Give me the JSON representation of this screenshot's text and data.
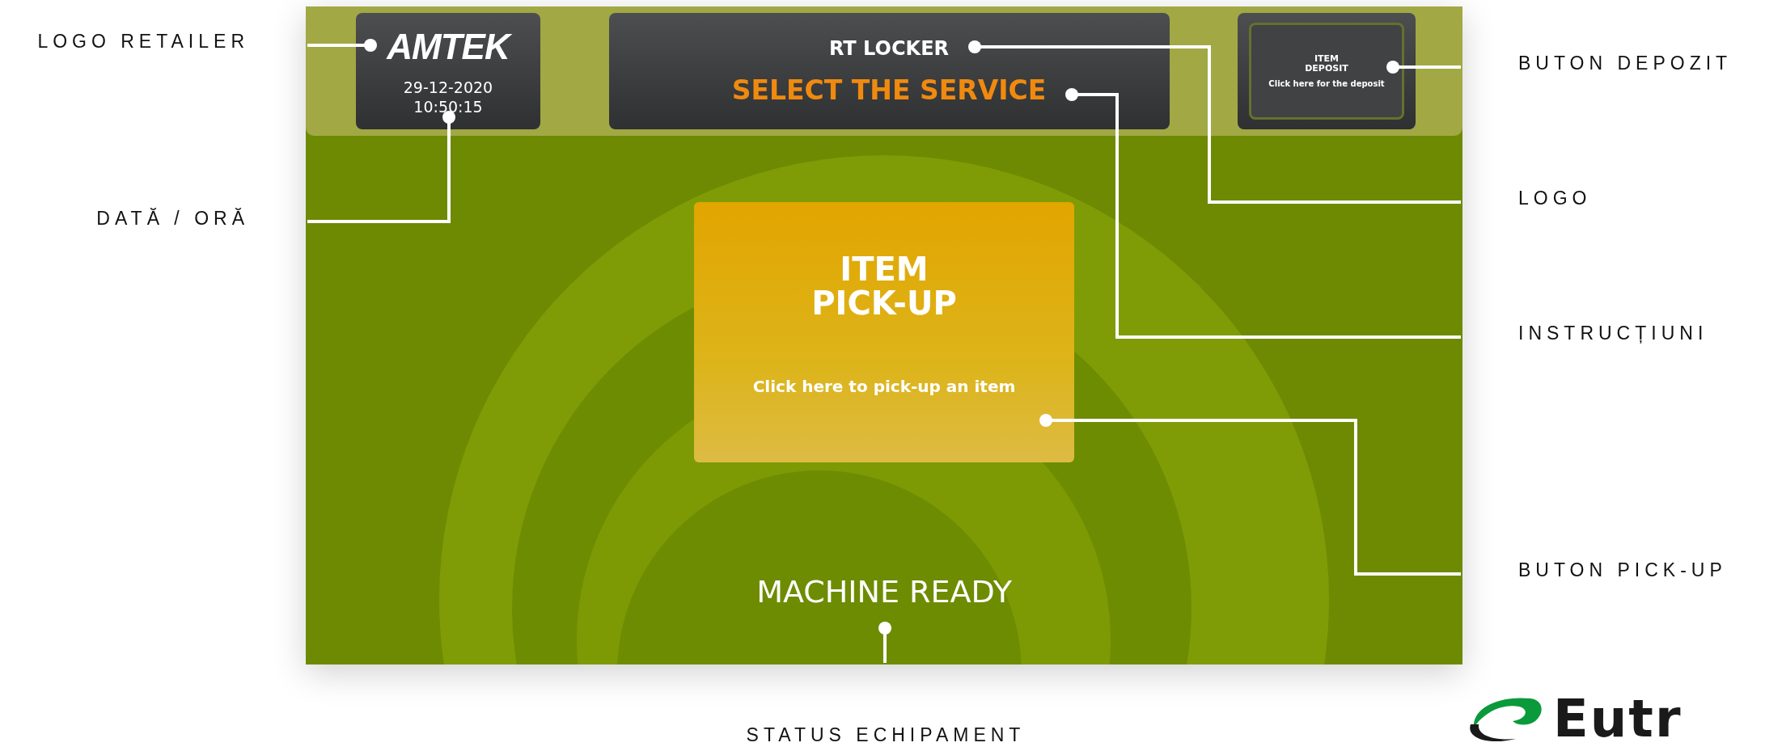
{
  "screen": {
    "retailer_logo": "AMTEK",
    "date": "29-12-2020",
    "time": "10:50:15",
    "header_title": "RT LOCKER",
    "instruction": "SELECT THE SERVICE",
    "deposit_button": {
      "title_lines": [
        "ITEM",
        "DEPOSIT"
      ],
      "hint": "Click here for the deposit"
    },
    "pickup_button": {
      "title_lines": [
        "ITEM",
        "PICK-UP"
      ],
      "hint": "Click here to pick-up an item"
    },
    "status": "MACHINE READY"
  },
  "annotations": [
    {
      "label": "LOGO RETAILER"
    },
    {
      "label": "DATĂ / ORĂ"
    },
    {
      "label": "BUTON DEPOZIT"
    },
    {
      "label": "LOGO"
    },
    {
      "label": "INSTRUCȚIUNI"
    },
    {
      "label": "BUTON PICK-UP"
    },
    {
      "label": "STATUS ECHIPAMENT"
    }
  ],
  "brand_logo": "Eutr"
}
